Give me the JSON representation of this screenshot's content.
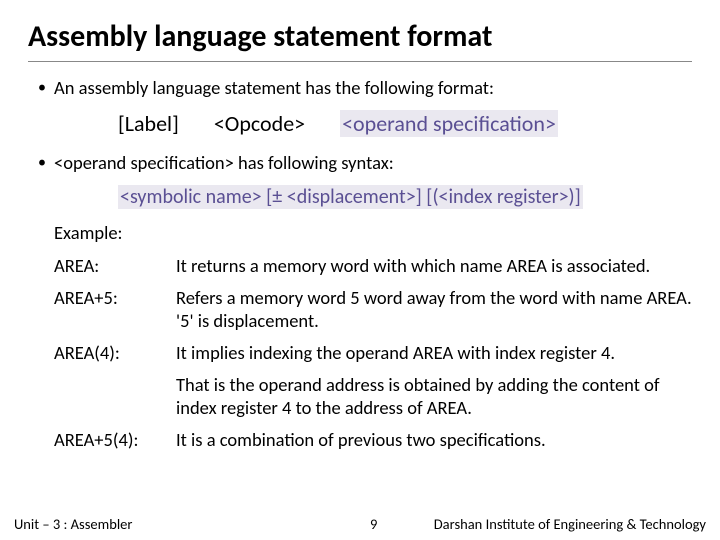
{
  "title": "Assembly language statement format",
  "bullet1": "An assembly language statement has the following format:",
  "fmt": {
    "label": "[Label]",
    "opcode": "<Opcode>",
    "operand": "<operand specification>"
  },
  "bullet2": "<operand specification> has following syntax:",
  "syntax": "<symbolic name> [± <displacement>] [(<index register>)]",
  "example_label": "Example:",
  "examples": [
    {
      "k": "AREA:",
      "v": "It returns a memory word with which name AREA is associated."
    },
    {
      "k": "AREA+5:",
      "v": "Refers a memory word 5 word away from the word with name AREA. '5' is displacement."
    },
    {
      "k": "AREA(4):",
      "v": "It implies indexing the operand AREA with index register 4."
    },
    {
      "k": "",
      "v": "That is the operand address is obtained by adding the content of index register 4 to the address of AREA."
    },
    {
      "k": "AREA+5(4):",
      "v": "It is a combination of previous two specifications."
    }
  ],
  "footer": {
    "left": "Unit – 3  : Assembler",
    "page": "9",
    "right": "Darshan Institute of Engineering & Technology"
  }
}
